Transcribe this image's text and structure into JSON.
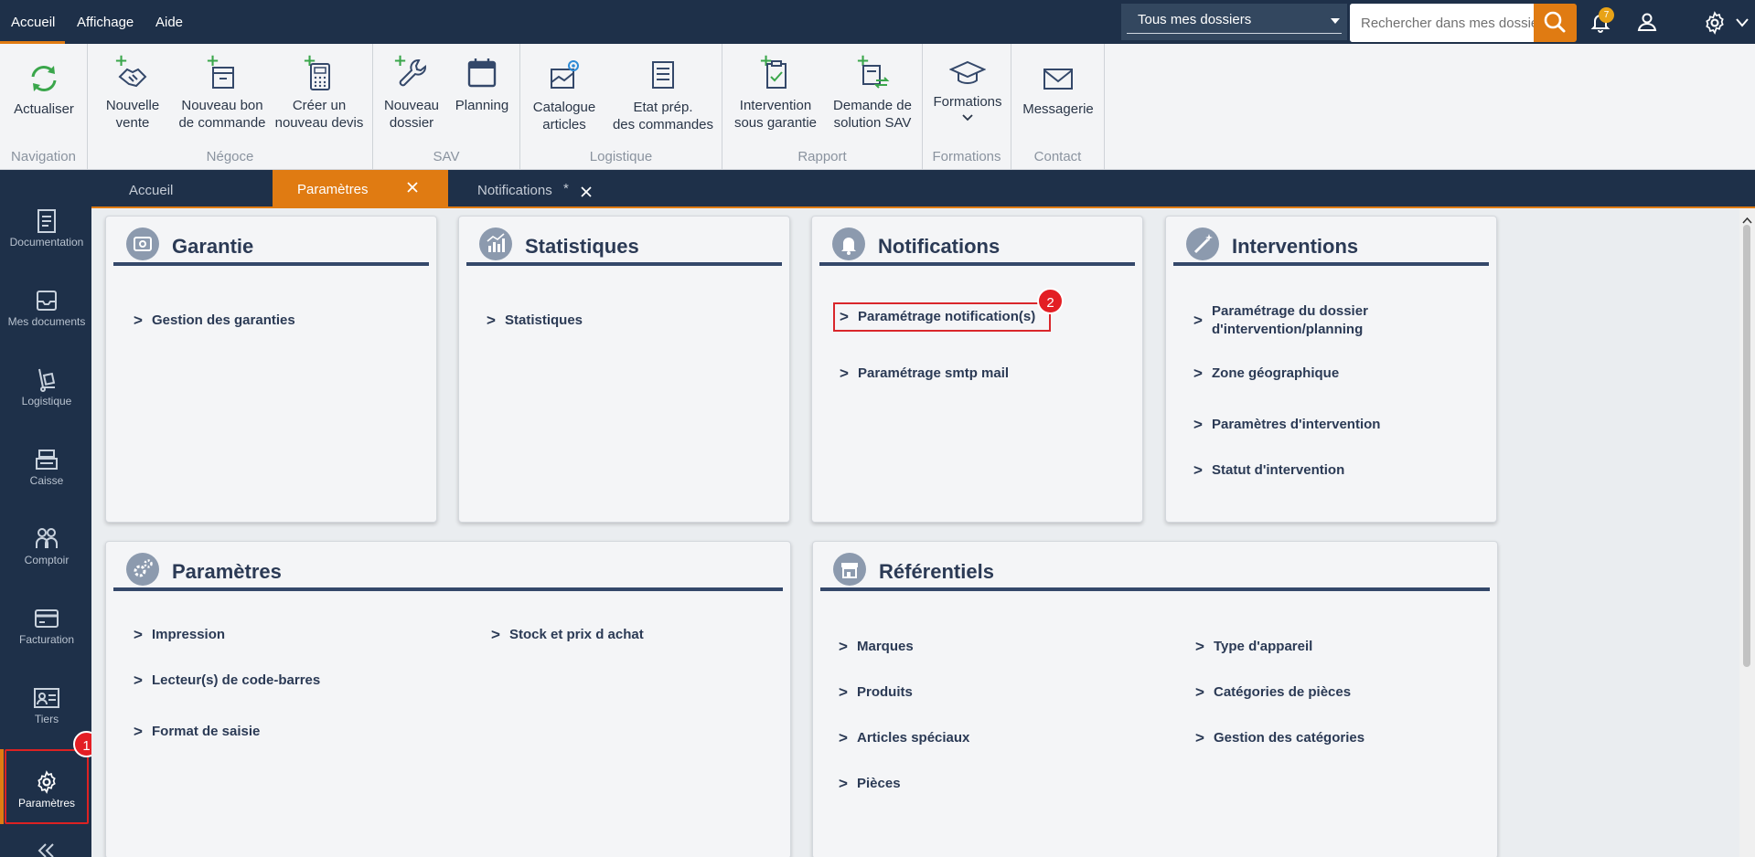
{
  "menu": {
    "items": [
      "Accueil",
      "Affichage",
      "Aide"
    ]
  },
  "topbar": {
    "dossier_select": "Tous mes dossiers",
    "search_placeholder": "Rechercher dans mes dossiers",
    "notifications_count": "7"
  },
  "ribbon": {
    "navigation": {
      "label": "Navigation",
      "refresh": "Actualiser"
    },
    "negoce": {
      "label": "Négoce",
      "new_sale": [
        "Nouvelle",
        "vente"
      ],
      "new_order": [
        "Nouveau bon",
        "de commande"
      ],
      "new_quote": [
        "Créer un",
        "nouveau devis"
      ]
    },
    "sav": {
      "label": "SAV",
      "new_file": [
        "Nouveau",
        "dossier"
      ],
      "planning": "Planning"
    },
    "logistique": {
      "label": "Logistique",
      "catalogue": [
        "Catalogue",
        "articles"
      ],
      "prep": [
        "Etat prép.",
        "des commandes"
      ]
    },
    "rapport": {
      "label": "Rapport",
      "intervention": [
        "Intervention",
        "sous garantie"
      ],
      "demande": [
        "Demande de",
        "solution SAV"
      ]
    },
    "formations": {
      "label": "Formations",
      "btn": "Formations"
    },
    "contact": {
      "label": "Contact",
      "messagerie": "Messagerie"
    }
  },
  "leftnav": {
    "items": [
      "Documentation",
      "Mes documents",
      "Logistique",
      "Caisse",
      "Comptoir",
      "Facturation",
      "Tiers",
      "Paramètres"
    ],
    "step1": "1"
  },
  "tabs": {
    "accueil": "Accueil",
    "parametres": "Paramètres",
    "notifications": "Notifications",
    "notifications_modified": "*"
  },
  "cards": {
    "garantie": {
      "title": "Garantie",
      "links": [
        "Gestion des garanties"
      ]
    },
    "statistiques": {
      "title": "Statistiques",
      "links": [
        "Statistiques"
      ]
    },
    "notifications": {
      "title": "Notifications",
      "links": [
        "Paramétrage notification(s)",
        "Paramétrage smtp mail"
      ],
      "step2": "2"
    },
    "interventions": {
      "title": "Interventions",
      "links": [
        "Paramétrage du dossier",
        "d'intervention/planning",
        "Zone géographique",
        "Paramètres d'intervention",
        "Statut d'intervention"
      ]
    },
    "parametres": {
      "title": "Paramètres",
      "links": [
        "Impression",
        "Lecteur(s) de code-barres",
        "Format de saisie",
        "Stock et prix d achat"
      ]
    },
    "referentiels": {
      "title": "Référentiels",
      "links": [
        "Marques",
        "Produits",
        "Articles spéciaux",
        "Pièces",
        "Type d'appareil",
        "Catégories de pièces",
        "Gestion des catégories"
      ]
    }
  },
  "colors": {
    "navy": "#1e3049",
    "orange": "#e07b12",
    "highlight_red": "#d9262b",
    "card_title": "#2b3a55"
  }
}
